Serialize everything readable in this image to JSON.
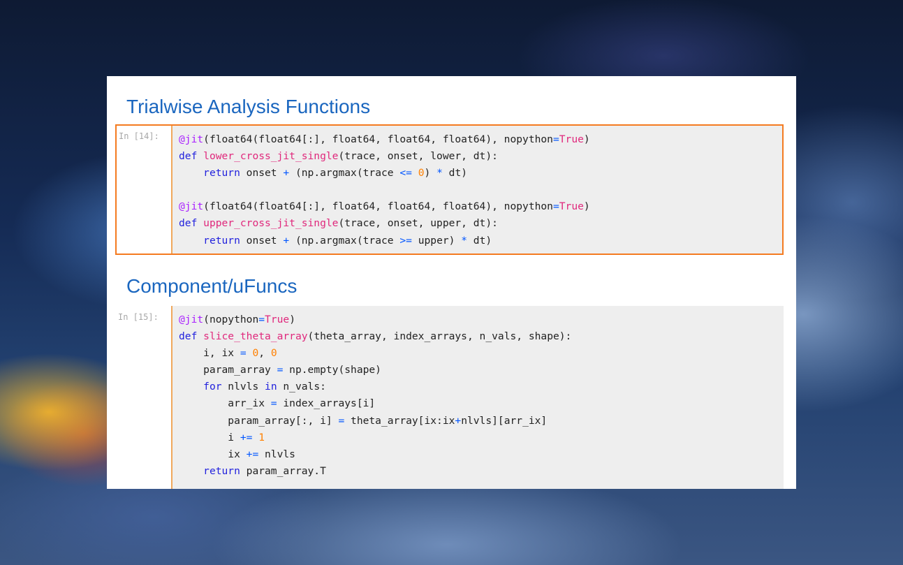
{
  "sections": [
    {
      "heading": "Trialwise Analysis Functions",
      "prompt": "In [14]:",
      "selected": true,
      "lines": [
        [
          [
            "deco",
            "@jit"
          ],
          [
            "p",
            "(float64(float64[:], float64, float64, float64), nopython"
          ],
          [
            "op",
            "="
          ],
          [
            "const",
            "True"
          ],
          [
            "p",
            ")"
          ]
        ],
        [
          [
            "kw",
            "def"
          ],
          [
            "p",
            " "
          ],
          [
            "fn",
            "lower_cross_jit_single"
          ],
          [
            "p",
            "(trace, onset, lower, dt):"
          ]
        ],
        [
          [
            "p",
            "    "
          ],
          [
            "kw",
            "return"
          ],
          [
            "p",
            " onset "
          ],
          [
            "op",
            "+"
          ],
          [
            "p",
            " (np.argmax(trace "
          ],
          [
            "op",
            "<="
          ],
          [
            "p",
            " "
          ],
          [
            "num",
            "0"
          ],
          [
            "p",
            ") "
          ],
          [
            "op",
            "*"
          ],
          [
            "p",
            " dt)"
          ]
        ],
        [],
        [
          [
            "deco",
            "@jit"
          ],
          [
            "p",
            "(float64(float64[:], float64, float64, float64), nopython"
          ],
          [
            "op",
            "="
          ],
          [
            "const",
            "True"
          ],
          [
            "p",
            ")"
          ]
        ],
        [
          [
            "kw",
            "def"
          ],
          [
            "p",
            " "
          ],
          [
            "fn",
            "upper_cross_jit_single"
          ],
          [
            "p",
            "(trace, onset, upper, dt):"
          ]
        ],
        [
          [
            "p",
            "    "
          ],
          [
            "kw",
            "return"
          ],
          [
            "p",
            " onset "
          ],
          [
            "op",
            "+"
          ],
          [
            "p",
            " (np.argmax(trace "
          ],
          [
            "op",
            ">="
          ],
          [
            "p",
            " upper) "
          ],
          [
            "op",
            "*"
          ],
          [
            "p",
            " dt)"
          ]
        ]
      ]
    },
    {
      "heading": "Component/uFuncs",
      "prompt": "In [15]:",
      "selected": false,
      "lines": [
        [
          [
            "deco",
            "@jit"
          ],
          [
            "p",
            "(nopython"
          ],
          [
            "op",
            "="
          ],
          [
            "const",
            "True"
          ],
          [
            "p",
            ")"
          ]
        ],
        [
          [
            "kw",
            "def"
          ],
          [
            "p",
            " "
          ],
          [
            "fn",
            "slice_theta_array"
          ],
          [
            "p",
            "(theta_array, index_arrays, n_vals, shape):"
          ]
        ],
        [
          [
            "p",
            "    i, ix "
          ],
          [
            "op",
            "="
          ],
          [
            "p",
            " "
          ],
          [
            "num",
            "0"
          ],
          [
            "p",
            ", "
          ],
          [
            "num",
            "0"
          ]
        ],
        [
          [
            "p",
            "    param_array "
          ],
          [
            "op",
            "="
          ],
          [
            "p",
            " np.empty(shape)"
          ]
        ],
        [
          [
            "p",
            "    "
          ],
          [
            "kw",
            "for"
          ],
          [
            "p",
            " nlvls "
          ],
          [
            "kw",
            "in"
          ],
          [
            "p",
            " n_vals:"
          ]
        ],
        [
          [
            "p",
            "        arr_ix "
          ],
          [
            "op",
            "="
          ],
          [
            "p",
            " index_arrays[i]"
          ]
        ],
        [
          [
            "p",
            "        param_array[:, i] "
          ],
          [
            "op",
            "="
          ],
          [
            "p",
            " theta_array[ix:ix"
          ],
          [
            "op",
            "+"
          ],
          [
            "p",
            "nlvls][arr_ix]"
          ]
        ],
        [
          [
            "p",
            "        i "
          ],
          [
            "op",
            "+="
          ],
          [
            "p",
            " "
          ],
          [
            "num",
            "1"
          ]
        ],
        [
          [
            "p",
            "        ix "
          ],
          [
            "op",
            "+="
          ],
          [
            "p",
            " nlvls"
          ]
        ],
        [
          [
            "p",
            "    "
          ],
          [
            "kw",
            "return"
          ],
          [
            "p",
            " param_array.T"
          ]
        ]
      ]
    }
  ],
  "colors": {
    "heading": "#1a66bf",
    "selected_border": "#f47b20",
    "prompt_border": "#f0a85c",
    "code_bg": "#eeeeee",
    "decorator": "#aa22ff",
    "keyword": "#2222dd",
    "function_name": "#e0287c",
    "number": "#ff8000",
    "operator": "#0055ff"
  }
}
